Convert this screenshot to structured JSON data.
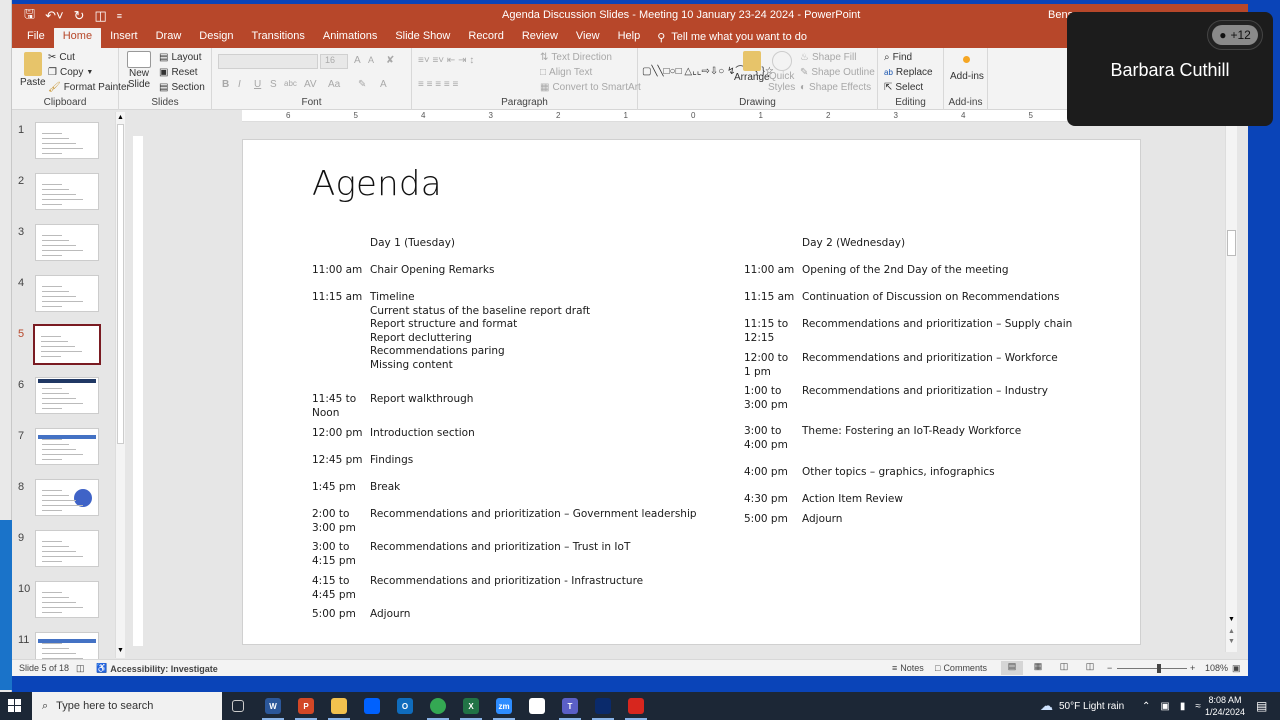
{
  "window": {
    "title": "Agenda Discussion Slides - Meeting 10 January 23-24 2024  -  PowerPoint",
    "user": "Bense",
    "qat": {
      "save_icon": "save-icon",
      "undo_icon": "undo-icon",
      "redo_icon": "redo-icon",
      "present_icon": "present-from-start-icon",
      "customize_icon": "customize-qat-icon"
    }
  },
  "tabs": [
    "File",
    "Home",
    "Insert",
    "Draw",
    "Design",
    "Transitions",
    "Animations",
    "Slide Show",
    "Record",
    "Review",
    "View",
    "Help"
  ],
  "active_tab": "Home",
  "tell_me": "Tell me what you want to do",
  "ribbon": {
    "clipboard": {
      "paste": "Paste",
      "cut": "Cut",
      "copy": "Copy",
      "format_painter": "Format Painter",
      "label": "Clipboard"
    },
    "slides": {
      "new_slide": "New",
      "new_slide2": "Slide",
      "layout": "Layout",
      "reset": "Reset",
      "section": "Section",
      "label": "Slides"
    },
    "font": {
      "font_name": "",
      "font_size": "16",
      "bold": "B",
      "italic": "I",
      "underline": "U",
      "shadow": "S",
      "strike": "abc",
      "spacing": "AV",
      "case": "Aa",
      "grow": "A",
      "shrink": "A",
      "color": "A",
      "label": "Font"
    },
    "paragraph": {
      "text_direction": "Text Direction",
      "align_text": "Align Text",
      "smartart": "Convert to SmartArt",
      "label": "Paragraph"
    },
    "drawing": {
      "arrange": "Arrange",
      "quick_styles": "Quick",
      "quick_styles2": "Styles",
      "shape_fill": "Shape Fill",
      "shape_outline": "Shape Outline",
      "shape_effects": "Shape Effects",
      "label": "Drawing"
    },
    "editing": {
      "find": "Find",
      "replace": "Replace",
      "select": "Select",
      "label": "Editing"
    },
    "addins": {
      "button": "Add-ins",
      "label": "Add-ins"
    }
  },
  "ruler": {
    "h_ticks": [
      "6",
      "5",
      "4",
      "3",
      "2",
      "1",
      "0",
      "1",
      "2",
      "3",
      "4",
      "5"
    ]
  },
  "thumbnails": [
    {
      "num": "1"
    },
    {
      "num": "2"
    },
    {
      "num": "3"
    },
    {
      "num": "4"
    },
    {
      "num": "5",
      "active": true
    },
    {
      "num": "6"
    },
    {
      "num": "7"
    },
    {
      "num": "8"
    },
    {
      "num": "9"
    },
    {
      "num": "10"
    },
    {
      "num": "11"
    }
  ],
  "slide": {
    "title": "Agenda",
    "day1": {
      "heading": "Day 1 (Tuesday)",
      "items": [
        {
          "time": "11:00 am",
          "desc": "Chair Opening Remarks"
        },
        {
          "time": "11:15 am",
          "desc": "Timeline\nCurrent status of the baseline report draft\nReport structure and format\nReport decluttering\nRecommendations paring\nMissing content"
        },
        {
          "time": "11:45 to\nNoon",
          "desc": "Report walkthrough"
        },
        {
          "time": "12:00 pm",
          "desc": "Introduction section"
        },
        {
          "time": "12:45 pm",
          "desc": "Findings"
        },
        {
          "time": "1:45 pm",
          "desc": "Break"
        },
        {
          "time": "2:00 to\n3:00 pm",
          "desc": "Recommendations and prioritization – Government leadership"
        },
        {
          "time": "3:00 to\n4:15 pm",
          "desc": "Recommendations and prioritization – Trust in IoT"
        },
        {
          "time": "4:15 to\n4:45 pm",
          "desc": "Recommendations and prioritization - Infrastructure"
        },
        {
          "time": "5:00 pm",
          "desc": "Adjourn"
        }
      ]
    },
    "day2": {
      "heading": "Day 2 (Wednesday)",
      "items": [
        {
          "time": "11:00 am",
          "desc": "Opening of the 2nd Day of the meeting"
        },
        {
          "time": "11:15 am",
          "desc": "Continuation of Discussion on Recommendations"
        },
        {
          "time": "11:15 to\n12:15",
          "desc": "Recommendations and prioritization – Supply chain"
        },
        {
          "time": "12:00 to\n1 pm",
          "desc": "Recommendations and prioritization – Workforce"
        },
        {
          "time": "1:00 to\n3:00 pm",
          "desc": "Recommendations and prioritization – Industry"
        },
        {
          "time": "3:00 to\n4:00 pm",
          "desc": "Theme: Fostering an IoT-Ready Workforce"
        },
        {
          "time": "4:00 pm",
          "desc": "Other topics – graphics, infographics"
        },
        {
          "time": "4:30 pm",
          "desc": "Action Item Review"
        },
        {
          "time": "5:00 pm",
          "desc": "Adjourn"
        }
      ]
    }
  },
  "status": {
    "slide_count": "Slide 5 of 18",
    "accessibility": "Accessibility: Investigate",
    "notes": "Notes",
    "comments": "Comments",
    "zoom": "108%",
    "zoom_fraction": 0.6
  },
  "meeting_overlay": {
    "speaker": "Barbara Cuthill",
    "participants": "+12"
  },
  "taskbar": {
    "search_placeholder": "Type here to search",
    "apps": [
      {
        "name": "task-view",
        "label": "",
        "color": "#1c2736"
      },
      {
        "name": "word",
        "label": "W",
        "color": "#2b579a"
      },
      {
        "name": "powerpoint",
        "label": "P",
        "color": "#d24726"
      },
      {
        "name": "file-explorer",
        "label": "",
        "color": "#f2c14e"
      },
      {
        "name": "dropbox",
        "label": "",
        "color": "#0061fe"
      },
      {
        "name": "outlook",
        "label": "O",
        "color": "#0f6cbd"
      },
      {
        "name": "chrome",
        "label": "",
        "color": "#34a853"
      },
      {
        "name": "excel",
        "label": "X",
        "color": "#217346"
      },
      {
        "name": "zoom",
        "label": "zm",
        "color": "#2d8cff"
      },
      {
        "name": "slack",
        "label": "",
        "color": "#ffffff"
      },
      {
        "name": "teams",
        "label": "T",
        "color": "#5b5fc7"
      },
      {
        "name": "webex",
        "label": "",
        "color": "#0a2a6b"
      },
      {
        "name": "acrobat",
        "label": "",
        "color": "#d7261e"
      }
    ],
    "weather": "50°F  Light rain",
    "time": "8:08 AM",
    "date": "1/24/2024"
  }
}
